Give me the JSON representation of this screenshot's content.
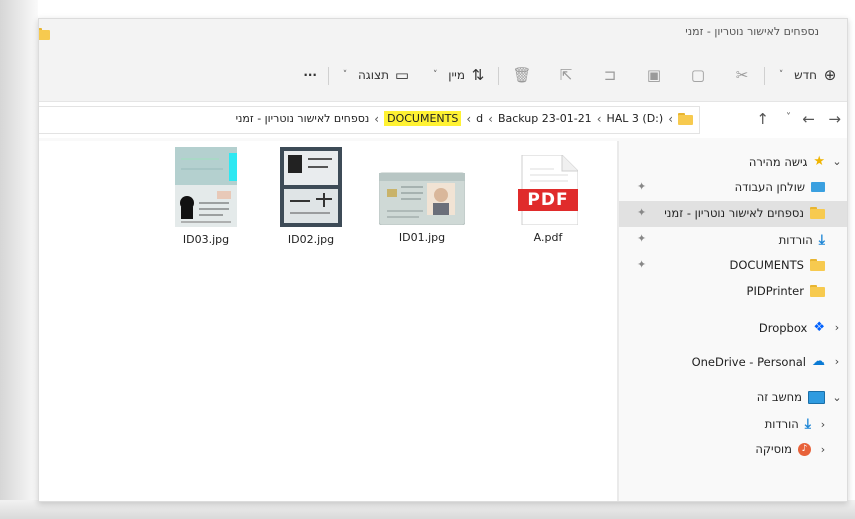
{
  "window": {
    "title": "נספחים לאישור נוטריון - זמני"
  },
  "toolbar": {
    "new_label": "חדש",
    "sort_label": "מיין",
    "view_label": "תצוגה",
    "more_label": "···"
  },
  "address": {
    "crumbs": [
      "HAL 3 (D:)",
      "Backup 23-01-21",
      "d",
      "DOCUMENTS",
      "נספחים לאישור נוטריון - זמני"
    ]
  },
  "sidebar": {
    "quick_access": "גישה מהירה",
    "items": [
      {
        "label": "שולחן העבודה"
      },
      {
        "label": "נספחים לאישור נוטריון - זמני"
      },
      {
        "label": "הורדות"
      },
      {
        "label": "DOCUMENTS"
      },
      {
        "label": "PIDPrinter"
      }
    ],
    "dropbox": "Dropbox",
    "onedrive": "OneDrive - Personal",
    "this_pc": "מחשב זה",
    "pc_items": [
      {
        "label": "הורדות"
      },
      {
        "label": "מוסיקה"
      }
    ]
  },
  "files": [
    {
      "name": "A.pdf",
      "thumb_text": "PDF"
    },
    {
      "name": "ID01.jpg"
    },
    {
      "name": "ID02.jpg"
    },
    {
      "name": "ID03.jpg"
    }
  ],
  "colors": {
    "highlight": "#fff233",
    "folder": "#f7ca4f",
    "pdf_red": "#e02b2b",
    "accent": "#0a7ad4"
  }
}
